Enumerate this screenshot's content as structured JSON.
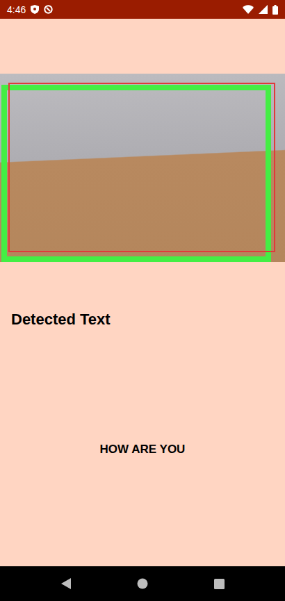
{
  "status_bar": {
    "time": "4:46"
  },
  "preview": {
    "detection_box": true
  },
  "heading": "Detected Text",
  "result": "HOW ARE YOU"
}
